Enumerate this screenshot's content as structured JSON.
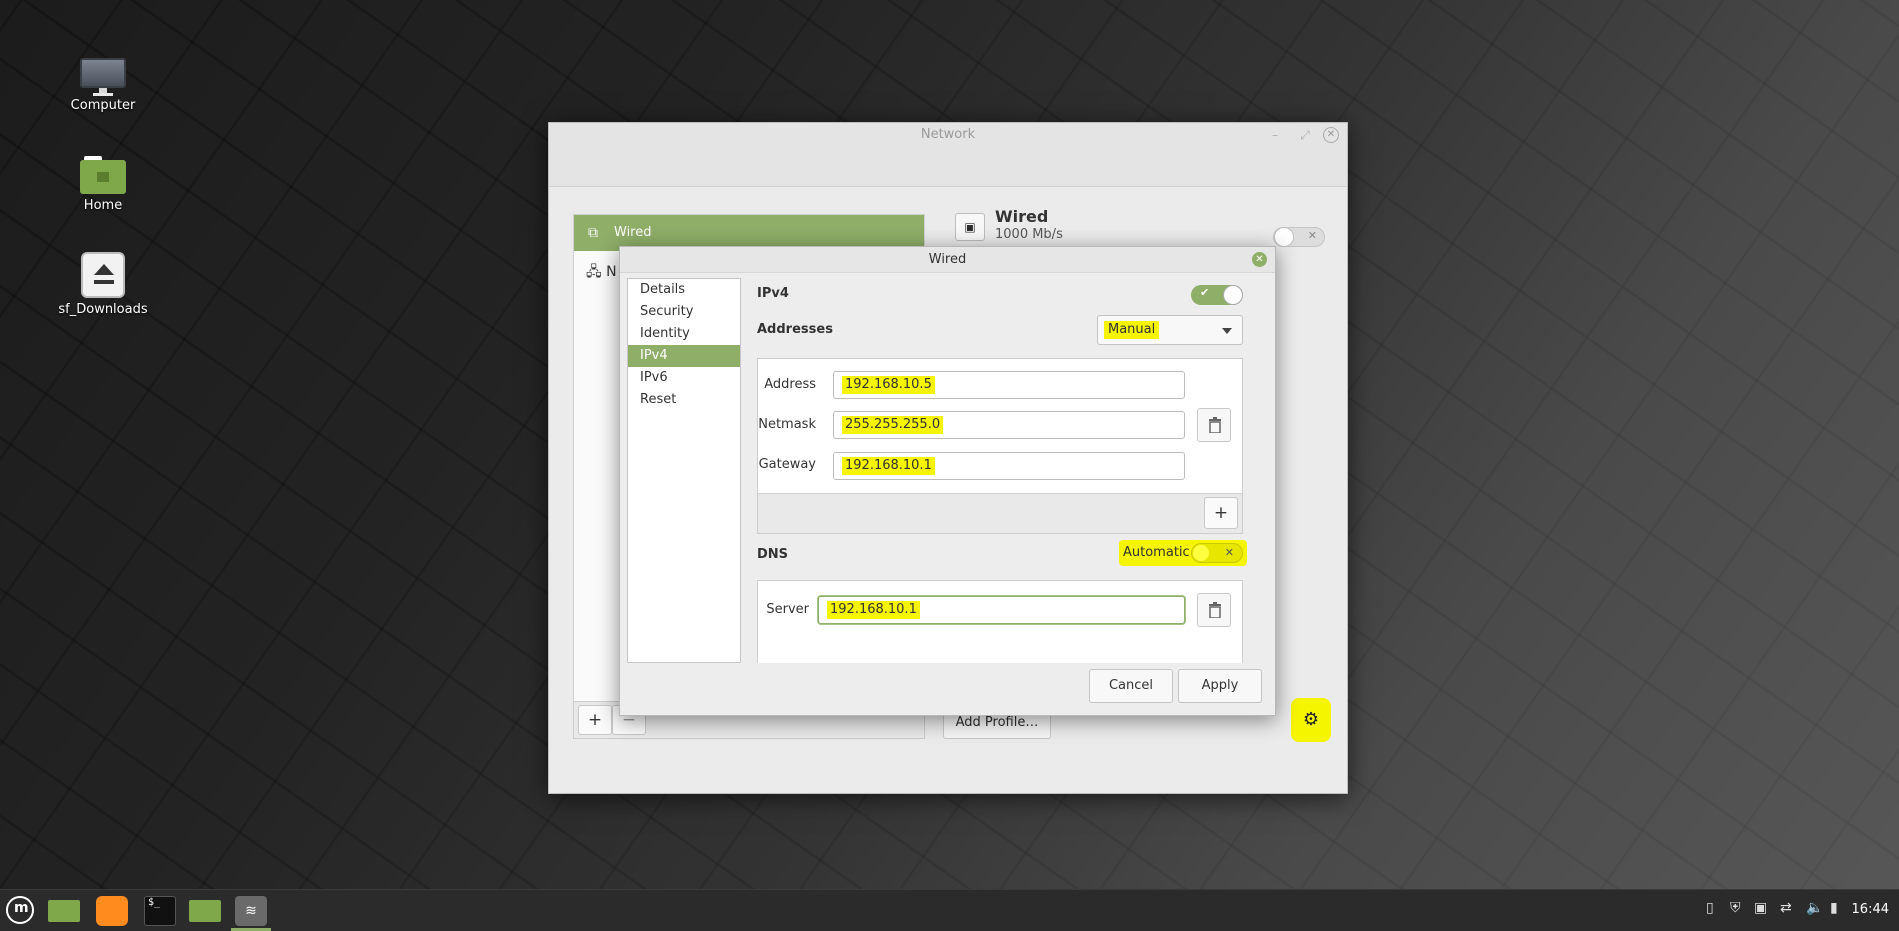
{
  "desktop": {
    "icons": [
      {
        "label": "Computer"
      },
      {
        "label": "Home"
      },
      {
        "label": "sf_Downloads"
      }
    ]
  },
  "network_window": {
    "title": "Network",
    "sidebar": {
      "items": [
        {
          "label": "Wired"
        },
        {
          "label": "N"
        }
      ]
    },
    "add_button": "+",
    "remove_button": "−",
    "wired_header": {
      "name": "Wired",
      "speed": "1000 Mb/s"
    },
    "add_profile_label": "Add Profile…",
    "settings_icon": "gear-icon"
  },
  "wired_dialog": {
    "title": "Wired",
    "nav": [
      {
        "label": "Details"
      },
      {
        "label": "Security"
      },
      {
        "label": "Identity"
      },
      {
        "label": "IPv4",
        "selected": true
      },
      {
        "label": "IPv6"
      },
      {
        "label": "Reset"
      }
    ],
    "ipv4": {
      "label": "IPv4",
      "enabled": true,
      "addresses_label": "Addresses",
      "method": "Manual",
      "address_label": "Address",
      "address": "192.168.10.5",
      "netmask_label": "Netmask",
      "netmask": "255.255.255.0",
      "gateway_label": "Gateway",
      "gateway": "192.168.10.1",
      "add_label": "+"
    },
    "dns": {
      "label": "DNS",
      "automatic_label": "Automatic",
      "automatic": false,
      "server_label": "Server",
      "server": "192.168.10.1"
    },
    "cancel_label": "Cancel",
    "apply_label": "Apply"
  },
  "taskbar": {
    "clock": "16:44"
  },
  "colors": {
    "accent": "#8fae68",
    "highlight": "#f5f500"
  }
}
